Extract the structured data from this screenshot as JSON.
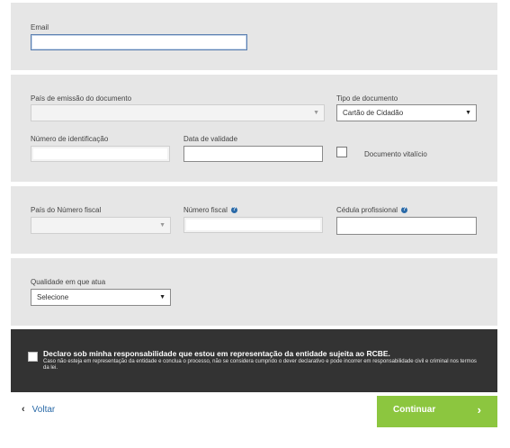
{
  "email_section": {
    "label": "Email",
    "value": ""
  },
  "document_section": {
    "issuing_country_label": "País de emissão do documento",
    "issuing_country_value": "",
    "doc_type_label": "Tipo de documento",
    "doc_type_value": "Cartão de Cidadão",
    "id_number_label": "Número de identificação",
    "expiry_label": "Data de validade",
    "lifetime_label": "Documento vitalício"
  },
  "fiscal_section": {
    "tax_country_label": "País do Número fiscal",
    "tax_number_label": "Número fiscal",
    "professional_card_label": "Cédula profissional"
  },
  "quality_section": {
    "label": "Qualidade em que atua",
    "value": "Selecione"
  },
  "declaration": {
    "title": "Declaro sob minha responsabilidade que estou em representação da entidade sujeita ao RCBE.",
    "subtitle": "Caso não esteja em representação da entidade e conclua o processo, não se considera cumprido o dever declarativo e pode incorrer em responsabilidade civil e criminal nos termos da lei."
  },
  "footer": {
    "back_label": "Voltar",
    "continue_label": "Continuar"
  },
  "icons": {
    "help": "help-icon",
    "dropdown": "caret-down-icon",
    "back": "chevron-left-icon",
    "forward": "chevron-right-icon"
  },
  "colors": {
    "panel": "#e6e6e6",
    "dark_panel": "#333333",
    "accent_green": "#8cc63f",
    "link_blue": "#2a6aa8"
  }
}
